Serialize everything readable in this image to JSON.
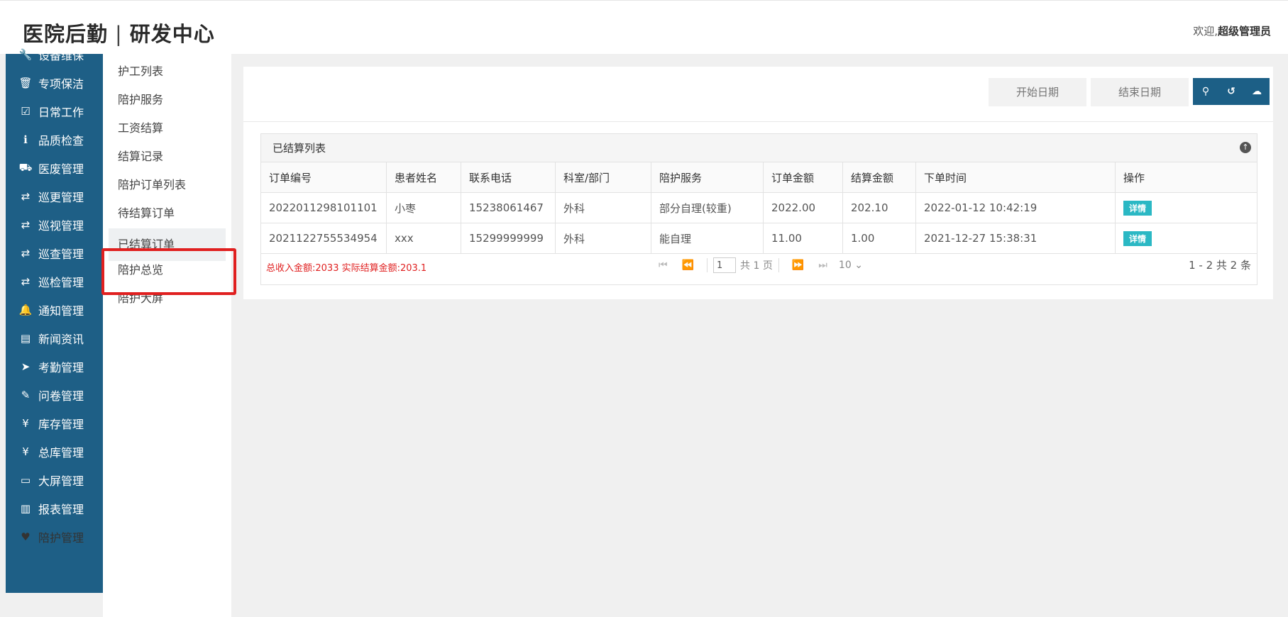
{
  "header": {
    "logo_part1": "医院后勤",
    "separator": "|",
    "logo_part2": "研发中心",
    "welcome_prefix": "欢迎,",
    "welcome_user": "超级管理员"
  },
  "sidebar": {
    "items": [
      {
        "icon": "wrench-icon",
        "glyph": "🔧",
        "label": "设备维保"
      },
      {
        "icon": "trash-icon",
        "glyph": "🗑",
        "label": "专项保洁"
      },
      {
        "icon": "checkbox-icon",
        "glyph": "☑",
        "label": "日常工作"
      },
      {
        "icon": "info-circle-icon",
        "glyph": "ℹ",
        "label": "品质检查"
      },
      {
        "icon": "truck-icon",
        "glyph": "⛟",
        "label": "医废管理"
      },
      {
        "icon": "random-icon",
        "glyph": "⇄",
        "label": "巡更管理"
      },
      {
        "icon": "random-icon",
        "glyph": "⇄",
        "label": "巡视管理"
      },
      {
        "icon": "random-icon",
        "glyph": "⇄",
        "label": "巡查管理"
      },
      {
        "icon": "random-icon",
        "glyph": "⇄",
        "label": "巡检管理"
      },
      {
        "icon": "bell-icon",
        "glyph": "🔔",
        "label": "通知管理"
      },
      {
        "icon": "newspaper-icon",
        "glyph": "▤",
        "label": "新闻资讯"
      },
      {
        "icon": "location-arrow-icon",
        "glyph": "➤",
        "label": "考勤管理"
      },
      {
        "icon": "edit-icon",
        "glyph": "✎",
        "label": "问卷管理"
      },
      {
        "icon": "yen-icon",
        "glyph": "¥",
        "label": "库存管理"
      },
      {
        "icon": "yen-icon",
        "glyph": "¥",
        "label": "总库管理"
      },
      {
        "icon": "desktop-icon",
        "glyph": "▭",
        "label": "大屏管理"
      },
      {
        "icon": "bar-chart-icon",
        "glyph": "▥",
        "label": "报表管理"
      },
      {
        "icon": "heartbeat-icon",
        "glyph": "♥",
        "label": "陪护管理"
      }
    ]
  },
  "submenu": {
    "items": [
      {
        "label": "护工列表"
      },
      {
        "label": "陪护服务"
      },
      {
        "label": "工资结算"
      },
      {
        "label": "结算记录"
      },
      {
        "label": "陪护订单列表"
      },
      {
        "label": "待结算订单"
      },
      {
        "label": "已结算订单"
      },
      {
        "label": "陪护总览"
      },
      {
        "label": "陪护大屏"
      }
    ],
    "active": "已结算订单"
  },
  "toolbar": {
    "start_placeholder": "开始日期",
    "end_placeholder": "结束日期"
  },
  "panel": {
    "title": "已结算列表"
  },
  "table": {
    "columns": [
      "订单编号",
      "患者姓名",
      "联系电话",
      "科室/部门",
      "陪护服务",
      "订单金额",
      "结算金额",
      "下单时间",
      "操作"
    ],
    "rows": [
      {
        "order_no": "2022011298101101",
        "patient": "小枣",
        "phone": "15238061467",
        "dept": "外科",
        "service": "部分自理(较重)",
        "order_amount": "2022.00",
        "settle_amount": "202.10",
        "time": "2022-01-12 10:42:19",
        "action": "详情"
      },
      {
        "order_no": "2021122755534954",
        "patient": "xxx",
        "phone": "15299999999",
        "dept": "外科",
        "service": "能自理",
        "order_amount": "11.00",
        "settle_amount": "1.00",
        "time": "2021-12-27 15:38:31",
        "action": "详情"
      }
    ]
  },
  "footer": {
    "totals": "总收入金额:2033 实际结算金额:203.1",
    "page_value": "1",
    "total_pages": "共 1 页",
    "page_size": "10",
    "range": "1 - 2  共 2 条"
  }
}
